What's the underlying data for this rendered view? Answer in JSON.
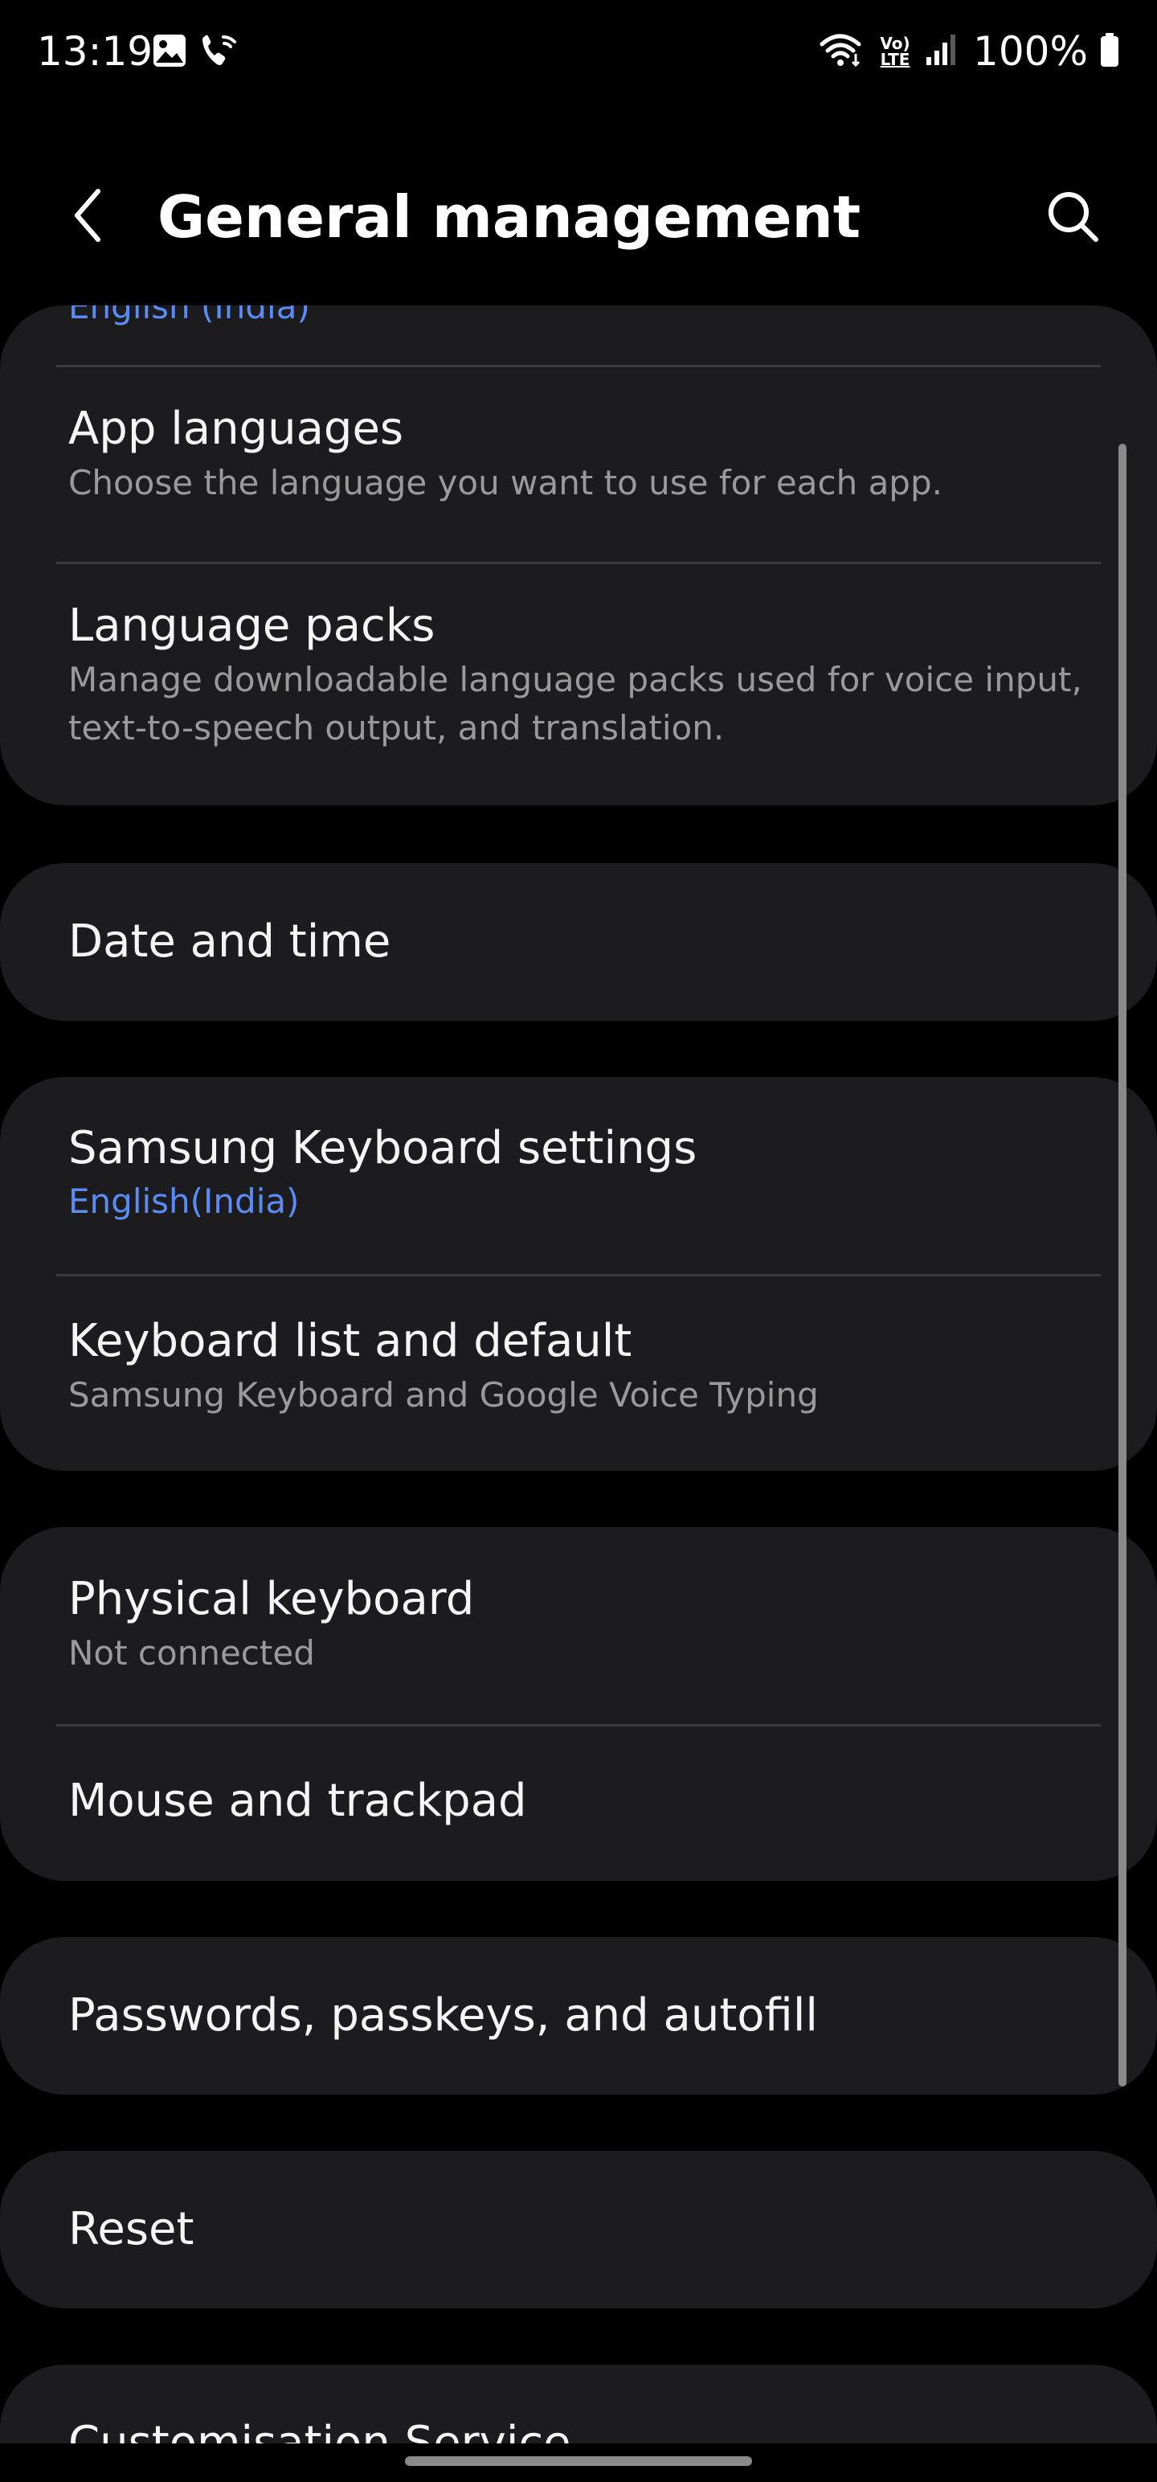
{
  "status_bar": {
    "time": "13:19",
    "left_icons": [
      "gallery-icon",
      "wifi-call-icon"
    ],
    "right_icons": [
      "wifi-icon",
      "volte-icon",
      "signal-icon",
      "battery-icon"
    ],
    "volte_line1": "Vo)",
    "volte_line2": "LTE",
    "battery": "100%"
  },
  "header": {
    "title": "General management",
    "back_icon": "back-arrow-icon",
    "search_icon": "search-icon"
  },
  "sections": {
    "language": {
      "current_language": "English (India)",
      "app_languages": {
        "title": "App languages",
        "subtitle": "Choose the language you want to use for each app."
      },
      "language_packs": {
        "title": "Language packs",
        "subtitle_line1": "Manage downloadable language packs used for voice input,",
        "subtitle_line2": "text-to-speech output, and translation."
      }
    },
    "date_time": {
      "title": "Date and time"
    },
    "keyboard": {
      "samsung_keyboard": {
        "title": "Samsung Keyboard settings",
        "subtitle": "English(India)"
      },
      "keyboard_list": {
        "title": "Keyboard list and default",
        "subtitle": "Samsung Keyboard and Google Voice Typing"
      }
    },
    "input_devices": {
      "physical_keyboard": {
        "title": "Physical keyboard",
        "subtitle": "Not connected"
      },
      "mouse_trackpad": {
        "title": "Mouse and trackpad"
      }
    },
    "passwords": {
      "title": "Passwords, passkeys, and autofill"
    },
    "reset": {
      "title": "Reset"
    },
    "customisation": {
      "title": "Customisation Service"
    }
  },
  "colors": {
    "background": "#000000",
    "card": "#1c1c1e",
    "accent_blue": "#5b8cf6",
    "secondary_text": "#9a9a9a",
    "divider": "#3a3a3c"
  }
}
